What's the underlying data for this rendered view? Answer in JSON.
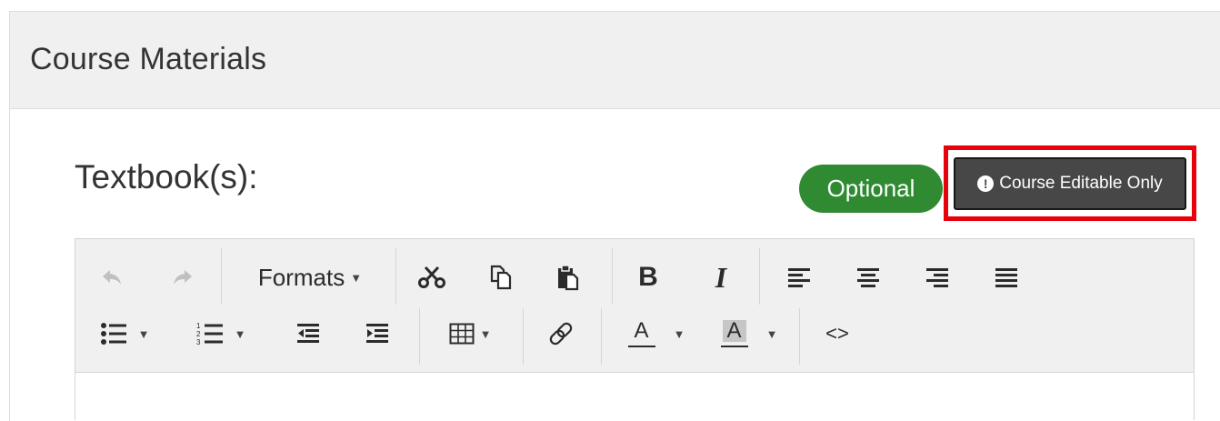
{
  "panel": {
    "title": "Course Materials"
  },
  "field": {
    "label": "Textbook(s):"
  },
  "badges": {
    "optional": "Optional"
  },
  "course_editable": {
    "label": "Course Editable Only",
    "icon": "exclamation-circle-icon"
  },
  "toolbar": {
    "formats_label": "Formats",
    "text_color_letter": "A",
    "bg_color_letter": "A",
    "code_label": "<>"
  },
  "colors": {
    "optional_badge": "#2f8a32",
    "highlight_border": "#e8000b",
    "editable_button": "#474747"
  }
}
